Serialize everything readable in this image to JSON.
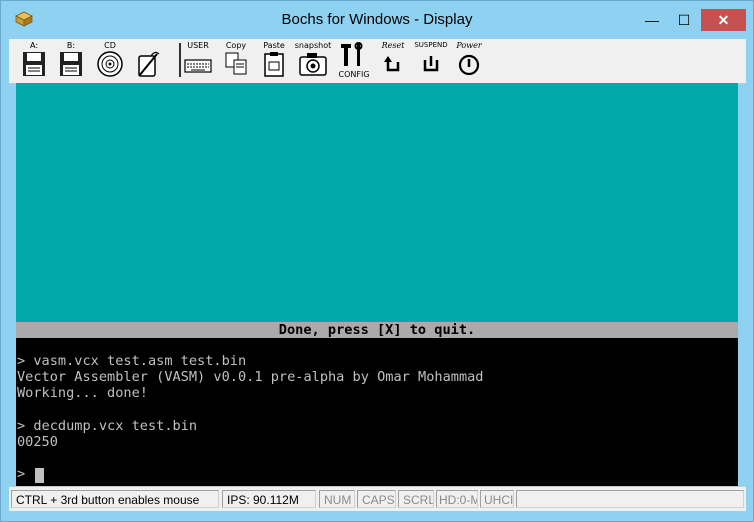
{
  "window": {
    "title": "Bochs for Windows - Display",
    "min_label": "—",
    "max_label": "☐",
    "close_label": "✕",
    "close_color": "#c75050"
  },
  "toolbar": {
    "items": [
      {
        "label": "A:",
        "icon": "floppy-a-icon"
      },
      {
        "label": "B:",
        "icon": "floppy-b-icon"
      },
      {
        "label": "CD",
        "icon": "cdrom-icon"
      },
      {
        "label": "",
        "icon": "mouse-icon"
      },
      {
        "label": "USER",
        "icon": "user-keyboard-icon"
      },
      {
        "label": "Copy",
        "icon": "copy-icon"
      },
      {
        "label": "Paste",
        "icon": "paste-icon"
      },
      {
        "label": "snapshot",
        "icon": "camera-icon"
      },
      {
        "label": "CONFIG",
        "icon": "config-icon"
      },
      {
        "label": "Reset",
        "icon": "reset-icon"
      },
      {
        "label": "SUSPEND",
        "icon": "suspend-icon"
      },
      {
        "label": "Power",
        "icon": "power-icon"
      }
    ]
  },
  "screen": {
    "cyan_color": "#00aaaa",
    "status_line": "Done, press [X] to quit.",
    "lines": [
      "> vasm.vcx test.asm test.bin",
      "Vector Assembler (VASM) v0.0.1 pre-alpha by Omar Mohammad",
      "Working... done!",
      "",
      "> decdump.vcx test.bin",
      "00250"
    ],
    "prompt": ">"
  },
  "statusbar": {
    "hint": "CTRL + 3rd button enables mouse",
    "ips": "IPS: 90.112M",
    "num": "NUM",
    "caps": "CAPS",
    "scrl": "SCRL",
    "hd": "HD:0-M",
    "uhci": "UHCI"
  }
}
